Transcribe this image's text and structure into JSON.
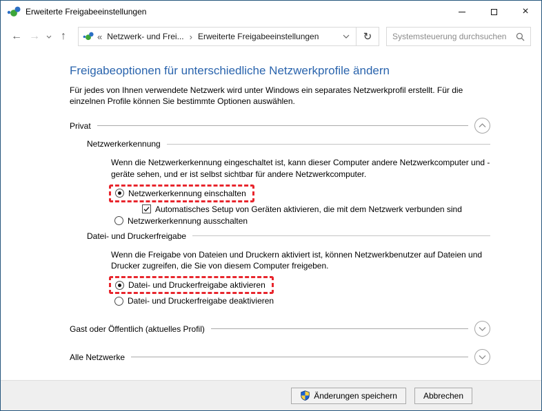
{
  "window": {
    "title": "Erweiterte Freigabeeinstellungen",
    "controls": {
      "minimize": "minimize",
      "maximize": "maximize",
      "close": "×"
    }
  },
  "toolbar": {
    "icons": {
      "back": "←",
      "forward": "→",
      "up": "↑",
      "refresh": "↻"
    },
    "breadcrumb": {
      "overflow_glyph": "«",
      "separator_glyph": "›",
      "items": [
        "Netzwerk- und Frei...",
        "Erweiterte Freigabeeinstellungen"
      ]
    },
    "search": {
      "placeholder": "Systemsteuerung durchsuchen"
    }
  },
  "main": {
    "heading": "Freigabeoptionen für unterschiedliche Netzwerkprofile ändern",
    "intro": "Für jedes von Ihnen verwendete Netzwerk wird unter Windows ein separates Netzwerkprofil erstellt. Für die einzelnen Profile können Sie bestimmte Optionen auswählen.",
    "sections": {
      "privat": {
        "label": "Privat",
        "expanded": true,
        "network_discovery": {
          "label": "Netzwerkerkennung",
          "description": "Wenn die Netzwerkerkennung eingeschaltet ist, kann dieser Computer andere Netzwerkcomputer und -geräte sehen, und er ist selbst sichtbar für andere Netzwerkcomputer.",
          "radio_on_label": "Netzwerkerkennung einschalten",
          "radio_on_selected": true,
          "checkbox_label": "Automatisches Setup von Geräten aktivieren, die mit dem Netzwerk verbunden sind",
          "checkbox_checked": true,
          "radio_off_label": "Netzwerkerkennung ausschalten",
          "radio_off_selected": false
        },
        "file_printer_sharing": {
          "label": "Datei- und Druckerfreigabe",
          "description": "Wenn die Freigabe von Dateien und Druckern aktiviert ist, können Netzwerkbenutzer auf Dateien und Drucker zugreifen, die Sie von diesem Computer freigeben.",
          "radio_on_label": "Datei- und Druckerfreigabe aktivieren",
          "radio_on_selected": true,
          "radio_off_label": "Datei- und Druckerfreigabe deaktivieren",
          "radio_off_selected": false
        }
      },
      "guest_public": {
        "label": "Gast oder Öffentlich (aktuelles Profil)",
        "expanded": false
      },
      "all_networks": {
        "label": "Alle Netzwerke",
        "expanded": false
      }
    },
    "annotations": {
      "highlight_color": "#e8262d",
      "highlight_style": "red-dashed-box"
    }
  },
  "footer": {
    "save_label": "Änderungen speichern",
    "cancel_label": "Abbrechen"
  },
  "colors": {
    "window_border": "#24557c",
    "heading_blue": "#2a64ad",
    "footer_bg": "#efefef",
    "share_icon_green": "#3da639",
    "share_icon_blue": "#2b6fc4",
    "uac_shield_blue": "#1a62d5",
    "uac_shield_yellow": "#ffd23e"
  }
}
